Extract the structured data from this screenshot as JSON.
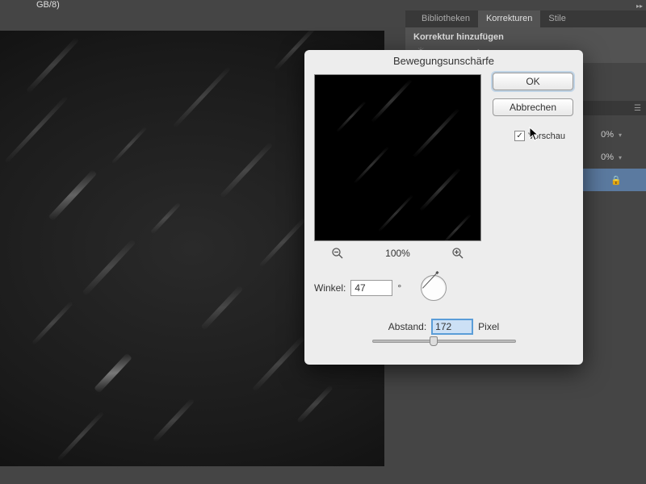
{
  "topbar": {
    "title_fragment": "GB/8)"
  },
  "panels": {
    "top_tabs": [
      "Bibliotheken",
      "Korrekturen",
      "Stile"
    ],
    "active_top_tab": 1,
    "adjustments_title": "Korrektur hinzufügen",
    "layer_opacity_label": "0% "
  },
  "dialog": {
    "title": "Bewegungsunschärfe",
    "ok_label": "OK",
    "cancel_label": "Abbrechen",
    "preview_label": "Vorschau",
    "preview_checked": true,
    "zoom_level": "100%",
    "angle_label": "Winkel:",
    "angle_value": "47",
    "degree_symbol": "°",
    "distance_label": "Abstand:",
    "distance_value": "172",
    "distance_unit": "Pixel",
    "slider_position_pct": 40
  }
}
